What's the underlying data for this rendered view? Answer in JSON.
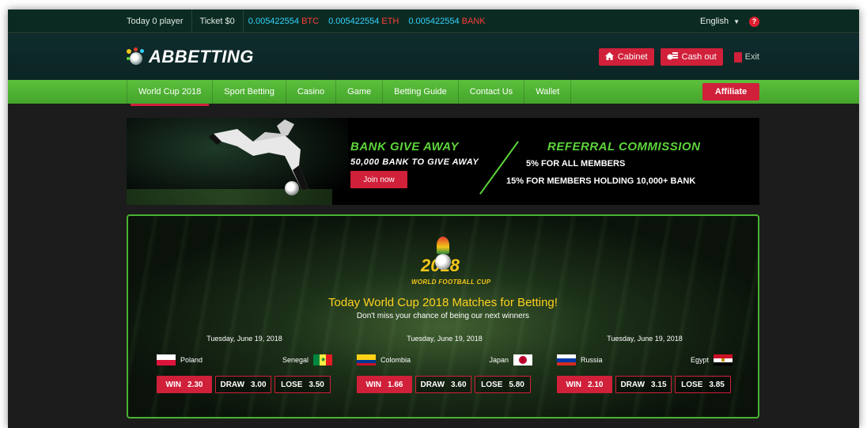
{
  "topbar": {
    "today_players": "Today 0 player",
    "ticket": "Ticket $0",
    "balances": [
      {
        "amount": "0.005422554",
        "currency": "BTC"
      },
      {
        "amount": "0.005422554",
        "currency": "ETH"
      },
      {
        "amount": "0.005422554",
        "currency": "BANK"
      }
    ],
    "language": "English",
    "help_glyph": "?"
  },
  "header": {
    "logo_text": "ABBETTING",
    "cabinet_label": "Cabinet",
    "cashout_label": "Cash out",
    "exit_label": "Exit"
  },
  "nav": {
    "items": [
      "World Cup 2018",
      "Sport Betting",
      "Casino",
      "Game",
      "Betting Guide",
      "Contact Us",
      "Wallet"
    ],
    "active_index": 0,
    "affiliate_label": "Affiliate"
  },
  "banner": {
    "left_title": "BANK GIVE AWAY",
    "left_sub": "50,000 BANK TO GIVE AWAY",
    "join_label": "Join now",
    "right_title": "REFERRAL COMMISSION",
    "right_line1": "5% FOR ALL MEMBERS",
    "right_line2": "15% FOR MEMBERS HOLDING 10,000+ BANK"
  },
  "worldcup": {
    "logo_year": "2018",
    "logo_sub": "WORLD FOOTBALL CUP",
    "heading": "Today World Cup 2018 Matches for Betting!",
    "subheading": "Don't miss your chance of being our next winners",
    "matches": [
      {
        "date": "Tuesday, June 19, 2018",
        "home": "Poland",
        "away": "Senegal",
        "win_label": "WIN",
        "win": "2.30",
        "draw_label": "DRAW",
        "draw": "3.00",
        "lose_label": "LOSE",
        "lose": "3.50"
      },
      {
        "date": "Tuesday, June 19, 2018",
        "home": "Colombia",
        "away": "Japan",
        "win_label": "WIN",
        "win": "1.66",
        "draw_label": "DRAW",
        "draw": "3.60",
        "lose_label": "LOSE",
        "lose": "5.80"
      },
      {
        "date": "Tuesday, June 19, 2018",
        "home": "Russia",
        "away": "Egypt",
        "win_label": "WIN",
        "win": "2.10",
        "draw_label": "DRAW",
        "draw": "3.15",
        "lose_label": "LOSE",
        "lose": "3.85"
      }
    ]
  },
  "colors": {
    "accent_red": "#d0203a",
    "nav_green": "#4caf32",
    "crypto_blue": "#33d2ff",
    "heading_yellow": "#ffd21f"
  }
}
